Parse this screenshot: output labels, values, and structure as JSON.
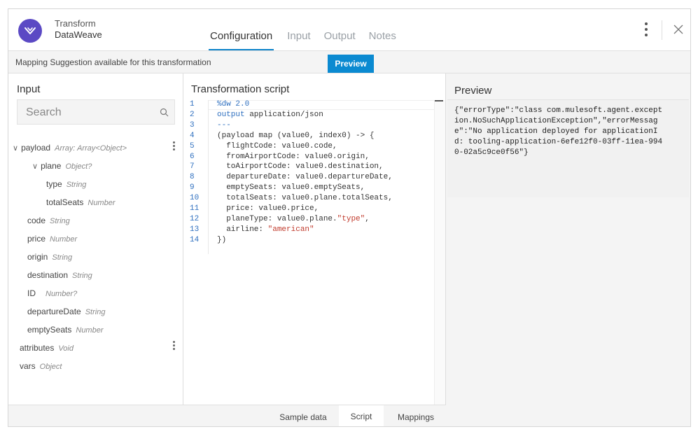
{
  "header": {
    "app_title_line1": "Transform",
    "app_title_line2": "DataWeave",
    "tabs": [
      {
        "label": "Configuration",
        "active": true
      },
      {
        "label": "Input",
        "active": false
      },
      {
        "label": "Output",
        "active": false
      },
      {
        "label": "Notes",
        "active": false
      }
    ],
    "brand_color": "#5b49c4",
    "accent_color": "#0b82c9"
  },
  "suggestion": {
    "text": "Mapping Suggestion available for this transformation",
    "button_label": "Preview"
  },
  "input_panel": {
    "title": "Input",
    "search_placeholder": "Search",
    "tree": [
      {
        "name": "payload",
        "type": "Array: Array<Object>",
        "expanded": true
      },
      {
        "name": "plane",
        "type": "Object?",
        "expanded": true
      },
      {
        "name": "type",
        "type": "String"
      },
      {
        "name": "totalSeats",
        "type": "Number"
      },
      {
        "name": "code",
        "type": "String"
      },
      {
        "name": "price",
        "type": "Number"
      },
      {
        "name": "origin",
        "type": "String"
      },
      {
        "name": "destination",
        "type": "String"
      },
      {
        "name": "ID",
        "type": "Number?"
      },
      {
        "name": "departureDate",
        "type": "String"
      },
      {
        "name": "emptySeats",
        "type": "Number"
      },
      {
        "name": "attributes",
        "type": "Void"
      },
      {
        "name": "vars",
        "type": "Object"
      }
    ]
  },
  "script_panel": {
    "title": "Transformation script",
    "lines": [
      "%dw 2.0",
      "output application/json",
      "---",
      "(payload map (value0, index0) -> {",
      "  flightCode: value0.code,",
      "  fromAirportCode: value0.origin,",
      "  toAirportCode: value0.destination,",
      "  departureDate: value0.departureDate,",
      "  emptySeats: value0.emptySeats,",
      "  totalSeats: value0.plane.totalSeats,",
      "  price: value0.price,",
      "  planeType: value0.plane.\"type\",",
      "  airline: \"american\"",
      "})"
    ],
    "bottom_tabs": [
      {
        "label": "Sample data",
        "active": false
      },
      {
        "label": "Script",
        "active": true
      },
      {
        "label": "Mappings",
        "active": false
      }
    ]
  },
  "preview_panel": {
    "title": "Preview",
    "content_lines": [
      "{\"errorType\":\"class com.mulesoft.agent.except",
      "ion.NoSuchApplicationException\",\"errorMessag",
      "e\":\"No application deployed for applicationI",
      "d: tooling-application-6efe12f0-03ff-11ea-994",
      "0-02a5c9ce0f56\"}"
    ]
  }
}
